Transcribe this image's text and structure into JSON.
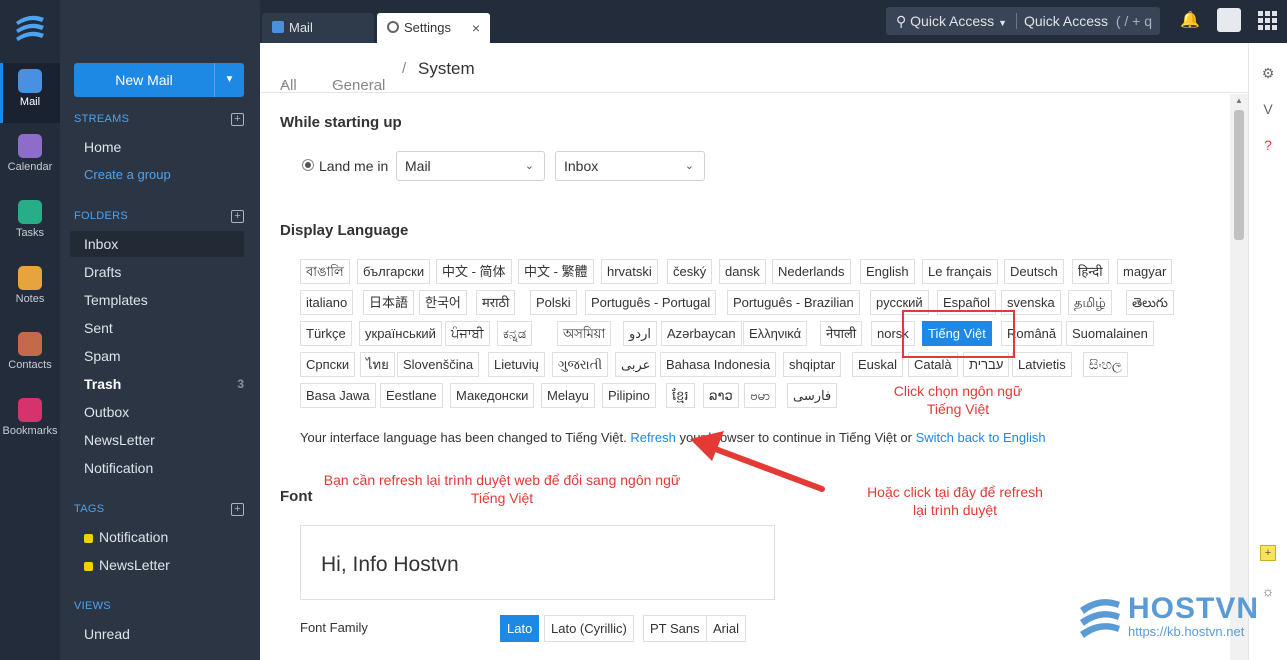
{
  "rail": {
    "items": [
      {
        "label": "Mail"
      },
      {
        "label": "Calendar"
      },
      {
        "label": "Tasks"
      },
      {
        "label": "Notes"
      },
      {
        "label": "Contacts"
      },
      {
        "label": "Bookmarks"
      }
    ]
  },
  "sidebar": {
    "new_mail": "New Mail",
    "streams_header": "STREAMS",
    "streams": [
      "Home",
      "Create a group"
    ],
    "folders_header": "FOLDERS",
    "folders": [
      {
        "label": "Inbox"
      },
      {
        "label": "Drafts"
      },
      {
        "label": "Templates"
      },
      {
        "label": "Sent"
      },
      {
        "label": "Spam"
      },
      {
        "label": "Trash",
        "count": "3"
      },
      {
        "label": "Outbox"
      },
      {
        "label": "NewsLetter"
      },
      {
        "label": "Notification"
      }
    ],
    "tags_header": "TAGS",
    "tags": [
      "Notification",
      "NewsLetter"
    ],
    "views_header": "VIEWS",
    "views": [
      "Unread"
    ]
  },
  "topbar": {
    "tabs": [
      "Mail",
      "Settings"
    ],
    "quick_access": "Quick Access",
    "quick_access_2": "Quick Access",
    "shortcut": "( / + q )"
  },
  "breadcrumb": {
    "all": "All",
    "general": "General",
    "current": "System"
  },
  "settings": {
    "startup_heading": "While starting up",
    "land_label": "Land me in",
    "land_app": "Mail",
    "land_folder": "Inbox",
    "language_heading": "Display Language",
    "languages": [
      "বাঙালি",
      "български",
      "中文 - 简体",
      "中文 - 繁體",
      "hrvatski",
      "český",
      "dansk",
      "Nederlands",
      "English",
      "Le français",
      "Deutsch",
      "हिन्दी",
      "magyar",
      "italiano",
      "日本語",
      "한국어",
      "मराठी",
      "Polski",
      "Português - Portugal",
      "Português - Brazilian",
      "русский",
      "Español",
      "svenska",
      "தமிழ்",
      "తెలుగు",
      "Türkçe",
      "український",
      "ਪੰਜਾਬੀ",
      "ಕನ್ನಡ",
      "অসমিয়া",
      "اردو",
      "Azərbaycan",
      "Ελληνικά",
      "नेपाली",
      "norsk",
      "Tiếng Việt",
      "Română",
      "Suomalainen",
      "Српски",
      "ไทย",
      "Slovenščina",
      "Lietuvių",
      "ગુજરાતી",
      "عربى",
      "Bahasa Indonesia",
      "shqiptar",
      "Euskal",
      "Català",
      "עברית",
      "Latvietis",
      "සිංහල",
      "Basa Jawa",
      "Eestlane",
      "Македонски",
      "Melayu",
      "Pilipino",
      "ខ្មែរ",
      "ລາວ",
      "ဗမာ",
      "فارسی"
    ],
    "selected_language": "Tiếng Việt",
    "notice_prefix": "Your interface language has been changed to Tiếng Việt.",
    "notice_refresh": "Refresh",
    "notice_middle": "your browser to continue in Tiếng Việt or",
    "notice_switch": "Switch back to English",
    "font_heading": "Font",
    "font_preview": "Hi, Info Hostvn",
    "font_family_label": "Font Family",
    "font_families": [
      "Lato",
      "Lato (Cyrillic)",
      "PT Sans",
      "Arial"
    ]
  },
  "annotations": {
    "click_select": "Click chọn ngôn ngữ Tiếng Việt",
    "need_refresh": "Bạn cần refresh lại trình duyệt web để đổi sang ngôn ngữ Tiếng Việt",
    "or_click": "Hoặc click tại đây để refresh lại trình duyệt"
  },
  "watermark": {
    "brand": "HOSTVN",
    "url": "https://kb.hostvn.net"
  },
  "colors": {
    "accent": "#1e88e5",
    "annotation": "#e53935",
    "rail": "#232c3b",
    "sidebar": "#2b3544"
  }
}
